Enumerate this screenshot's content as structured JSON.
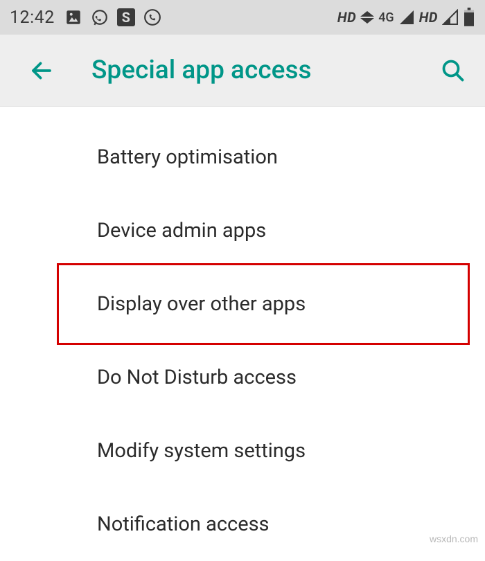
{
  "status_bar": {
    "time": "12:42",
    "left_icons": [
      "gallery-icon",
      "whatsapp-icon",
      "app-s-icon",
      "phone-circle-icon"
    ],
    "right": {
      "hd1": "HD",
      "net_type": "4G",
      "hd2": "HD"
    }
  },
  "app_bar": {
    "title": "Special app access"
  },
  "accent_color": "#009688",
  "list": {
    "items": [
      {
        "label": "Battery optimisation",
        "highlighted": false
      },
      {
        "label": "Device admin apps",
        "highlighted": false
      },
      {
        "label": "Display over other apps",
        "highlighted": true
      },
      {
        "label": "Do Not Disturb access",
        "highlighted": false
      },
      {
        "label": "Modify system settings",
        "highlighted": false
      },
      {
        "label": "Notification access",
        "highlighted": false
      }
    ]
  },
  "watermark": "wsxdn.com"
}
